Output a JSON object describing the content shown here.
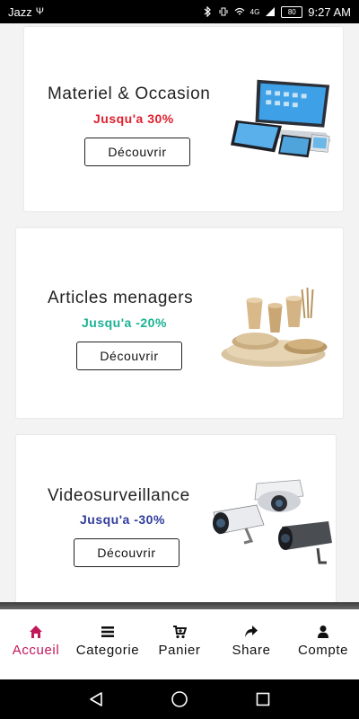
{
  "status_bar": {
    "carrier": "Jazz",
    "network": "4G",
    "battery": "80",
    "time": "9:27 AM"
  },
  "cards": [
    {
      "title": "Materiel & Occasion",
      "promo": "Jusqu'a 30%",
      "promo_color": "#e0202e",
      "button": "Découvrir",
      "image": "laptop-tablet-phones-image"
    },
    {
      "title": "Articles menagers",
      "promo": "Jusqu'a -20%",
      "promo_color": "#1ab394",
      "button": "Découvrir",
      "image": "tableware-image"
    },
    {
      "title": "Videosurveillance",
      "promo": "Jusqu'a -30%",
      "promo_color": "#2f3c9c",
      "button": "Découvrir",
      "image": "security-cameras-image"
    }
  ],
  "bottom_nav": {
    "active_color": "#c2185b",
    "items": [
      {
        "label": "Accueil",
        "icon": "home-icon",
        "active": true
      },
      {
        "label": "Categorie",
        "icon": "list-icon",
        "active": false
      },
      {
        "label": "Panier",
        "icon": "cart-icon",
        "active": false
      },
      {
        "label": "Share",
        "icon": "share-icon",
        "active": false
      },
      {
        "label": "Compte",
        "icon": "user-icon",
        "active": false
      }
    ]
  },
  "system_nav": [
    "back-icon",
    "home-circle-icon",
    "recents-icon"
  ]
}
